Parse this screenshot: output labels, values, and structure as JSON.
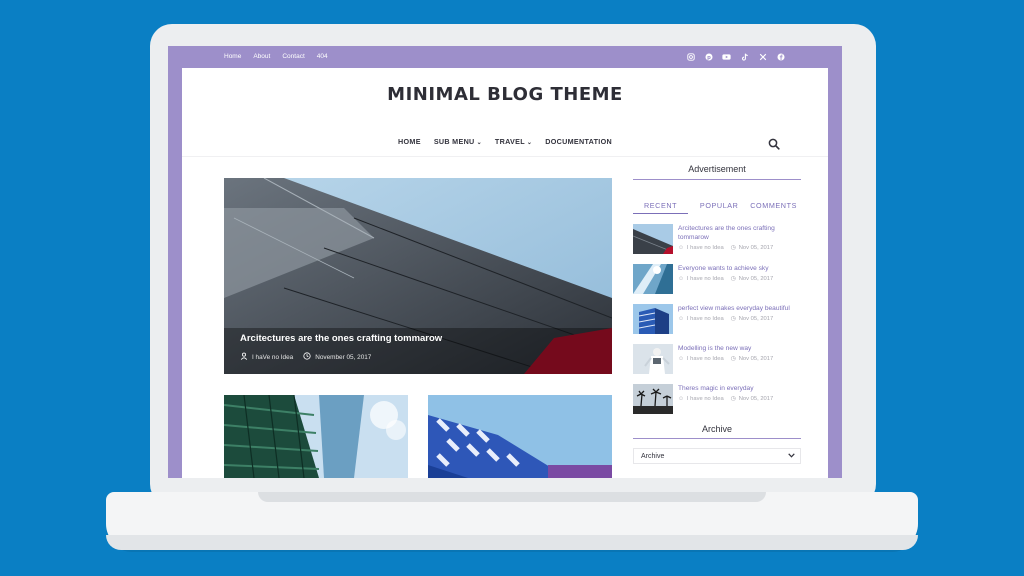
{
  "topbar": {
    "links": [
      "Home",
      "About",
      "Contact",
      "404"
    ],
    "socials": [
      "instagram-icon",
      "pinterest-icon",
      "youtube-icon",
      "tiktok-icon",
      "x-icon",
      "facebook-icon"
    ]
  },
  "header": {
    "title": "MINIMAL BLOG THEME"
  },
  "nav": {
    "home": "HOME",
    "sub_menu": "SUB MENU",
    "travel": "TRAVEL",
    "documentation": "DOCUMENTATION"
  },
  "hero": {
    "title": "Arcitectures are the ones crafting tommarow",
    "author": "I haVe no Idea",
    "date": "November 05, 2017"
  },
  "sidebar": {
    "advert_heading": "Advertisement",
    "tabs": [
      "RECENT",
      "POPULAR",
      "COMMENTS"
    ],
    "posts": [
      {
        "title": "Arcitectures are the ones crafting tommarow",
        "author": "I have no Idea",
        "date": "Nov 05, 2017"
      },
      {
        "title": "Everyone wants to achieve sky",
        "author": "I have no Idea",
        "date": "Nov 05, 2017"
      },
      {
        "title": "perfect view makes everyday beautiful",
        "author": "I have no Idea",
        "date": "Nov 05, 2017"
      },
      {
        "title": "Modelling is the new way",
        "author": "I have no Idea",
        "date": "Nov 05, 2017"
      },
      {
        "title": "Theres magic in everyday",
        "author": "I have no Idea",
        "date": "Nov 05, 2017"
      }
    ],
    "archive_heading": "Archive",
    "archive_select": "Archive"
  },
  "colors": {
    "background": "#0a7fc4",
    "accent": "#9d8fca",
    "link": "#7b6fb8"
  }
}
